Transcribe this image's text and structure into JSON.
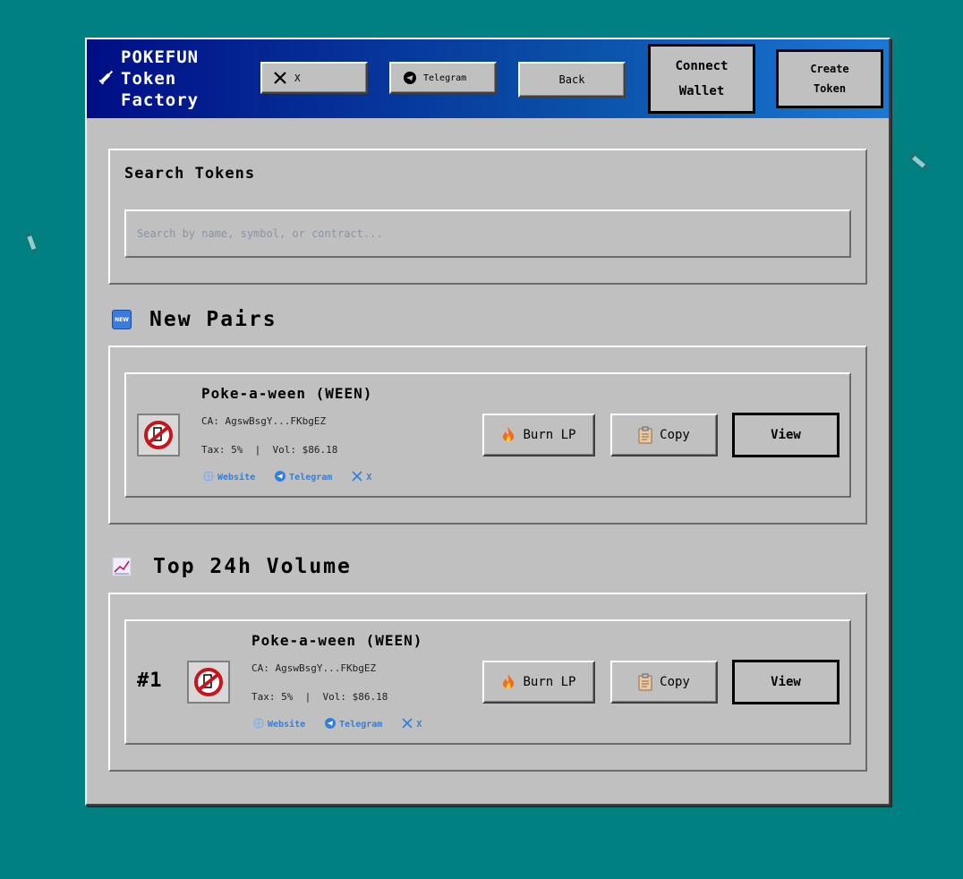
{
  "header": {
    "brand_line1": "POKEFUN",
    "brand_line2": "Token",
    "brand_line3": "Factory",
    "x_label": "X",
    "telegram_label": "Telegram",
    "back_label": "Back",
    "connect_line1": "Connect",
    "connect_line2": "Wallet",
    "create_line1": "Create",
    "create_line2": "Token"
  },
  "search": {
    "label": "Search Tokens",
    "placeholder": "Search by name, symbol, or contract..."
  },
  "new_pairs": {
    "title": "New Pairs",
    "badge": "NEW",
    "token": {
      "name": "Poke-a-ween (WEEN)",
      "ca": "CA: AgswBsgY...FKbgEZ",
      "stats": "Tax: 5%  |  Vol: $86.18",
      "website_label": "Website",
      "telegram_label": "Telegram",
      "x_label": "X",
      "burn_label": "Burn LP",
      "copy_label": "Copy",
      "view_label": "View"
    }
  },
  "top_volume": {
    "title": "Top 24h Volume",
    "token": {
      "rank": "#1",
      "name": "Poke-a-ween (WEEN)",
      "ca": "CA: AgswBsgY...FKbgEZ",
      "stats": "Tax: 5%  |  Vol: $86.18",
      "website_label": "Website",
      "telegram_label": "Telegram",
      "x_label": "X",
      "burn_label": "Burn LP",
      "copy_label": "Copy",
      "view_label": "View"
    }
  },
  "colors": {
    "desktop": "#008080",
    "window": "#c0c0c0",
    "titlebar_start": "#000e86",
    "titlebar_end": "#1a78d4",
    "link": "#2f7fe0"
  }
}
